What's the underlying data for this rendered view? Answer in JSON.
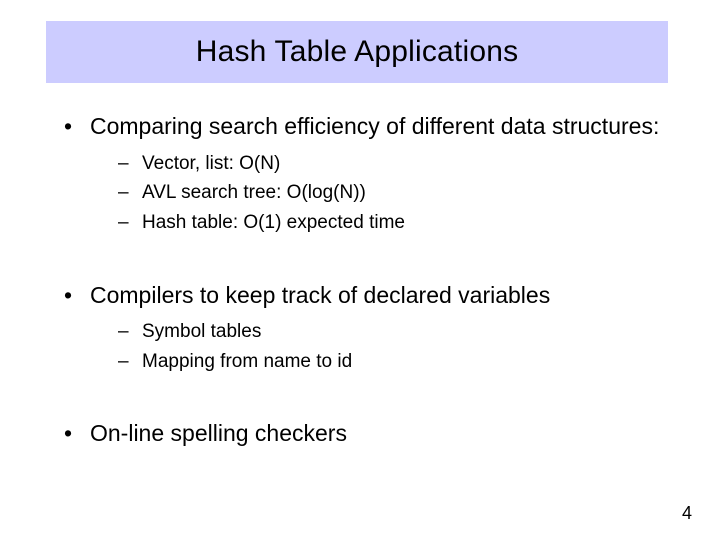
{
  "title": "Hash Table Applications",
  "bullets": [
    {
      "text": "Comparing search efficiency of different data structures:",
      "sub": [
        "Vector, list: O(N)",
        "AVL search tree: O(log(N))",
        "Hash table: O(1) expected time"
      ]
    },
    {
      "text": "Compilers to keep track of declared variables",
      "sub": [
        "Symbol tables",
        "Mapping from name to id"
      ]
    },
    {
      "text": "On-line spelling checkers",
      "sub": []
    }
  ],
  "page_number": "4"
}
